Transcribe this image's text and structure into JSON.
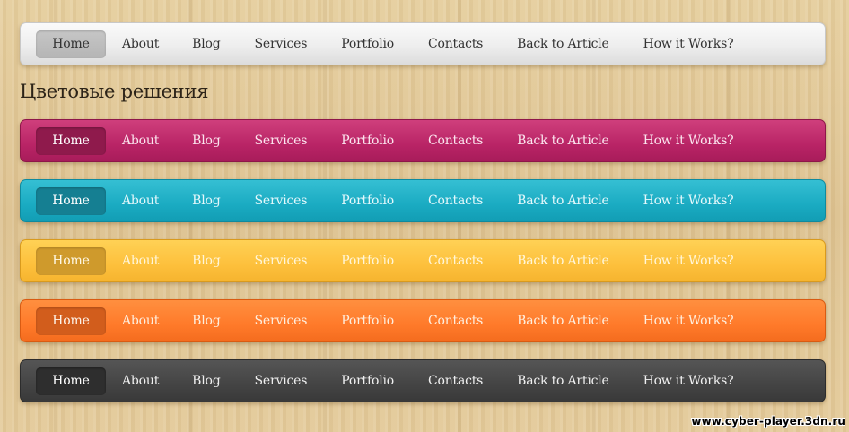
{
  "colors": {
    "light": "#eeeeee",
    "magenta": "#b92466",
    "teal": "#1aabc2",
    "yellow": "#fdc03c",
    "orange": "#ff7a2a",
    "dark": "#444444"
  },
  "menu": {
    "items": [
      "Home",
      "About",
      "Blog",
      "Services",
      "Portfolio",
      "Contacts",
      "Back to Article",
      "How it Works?"
    ],
    "active": "Home"
  },
  "section_title": "Цветовые решения",
  "watermark": "www.cyber-player.3dn.ru"
}
